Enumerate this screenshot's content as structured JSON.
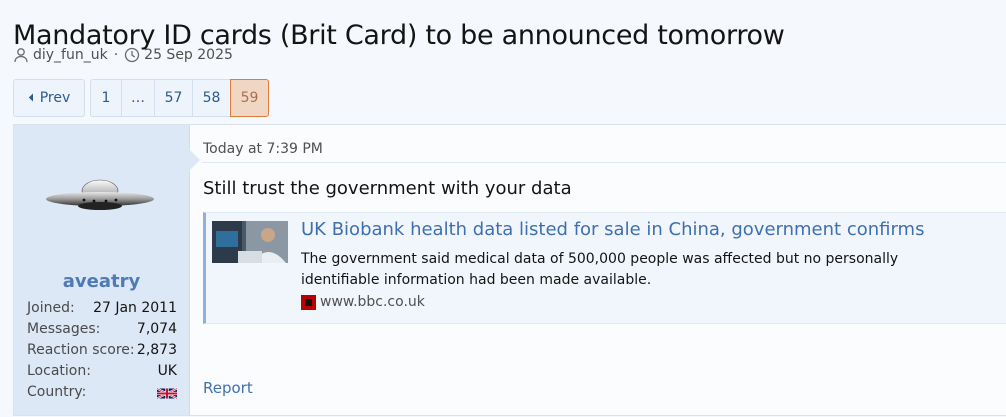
{
  "thread": {
    "title": "Mandatory ID cards (Brit Card) to be announced tomorrow",
    "author": "diy_fun_uk",
    "separator": "·",
    "date": "25 Sep 2025"
  },
  "pagination": {
    "prev_label": "Prev",
    "pages": [
      "1",
      "…",
      "57",
      "58",
      "59"
    ],
    "current": "59"
  },
  "post": {
    "user": {
      "name": "aveatry",
      "stats": [
        {
          "label": "Joined:",
          "value": "27 Jan 2011"
        },
        {
          "label": "Messages:",
          "value": "7,074"
        },
        {
          "label": "Reaction score:",
          "value": "2,873"
        },
        {
          "label": "Location:",
          "value": "UK"
        },
        {
          "label": "Country:",
          "value": ""
        }
      ],
      "country_flag": "union-jack"
    },
    "date": "Today at 7:39 PM",
    "text": "Still trust the government with your data",
    "unfurl": {
      "title": "UK Biobank health data listed for sale in China, government confirms",
      "description": "The government said medical data of 500,000 people was affected but no personally identifiable information had been made available.",
      "domain": "www.bbc.co.uk"
    },
    "report_label": "Report"
  },
  "colors": {
    "link": "#3f6fae",
    "username": "#4f7ab5",
    "current_page_bg": "#f0d7c4",
    "current_page_border": "#e07c3e",
    "user_cell_bg": "#dde8f6"
  }
}
